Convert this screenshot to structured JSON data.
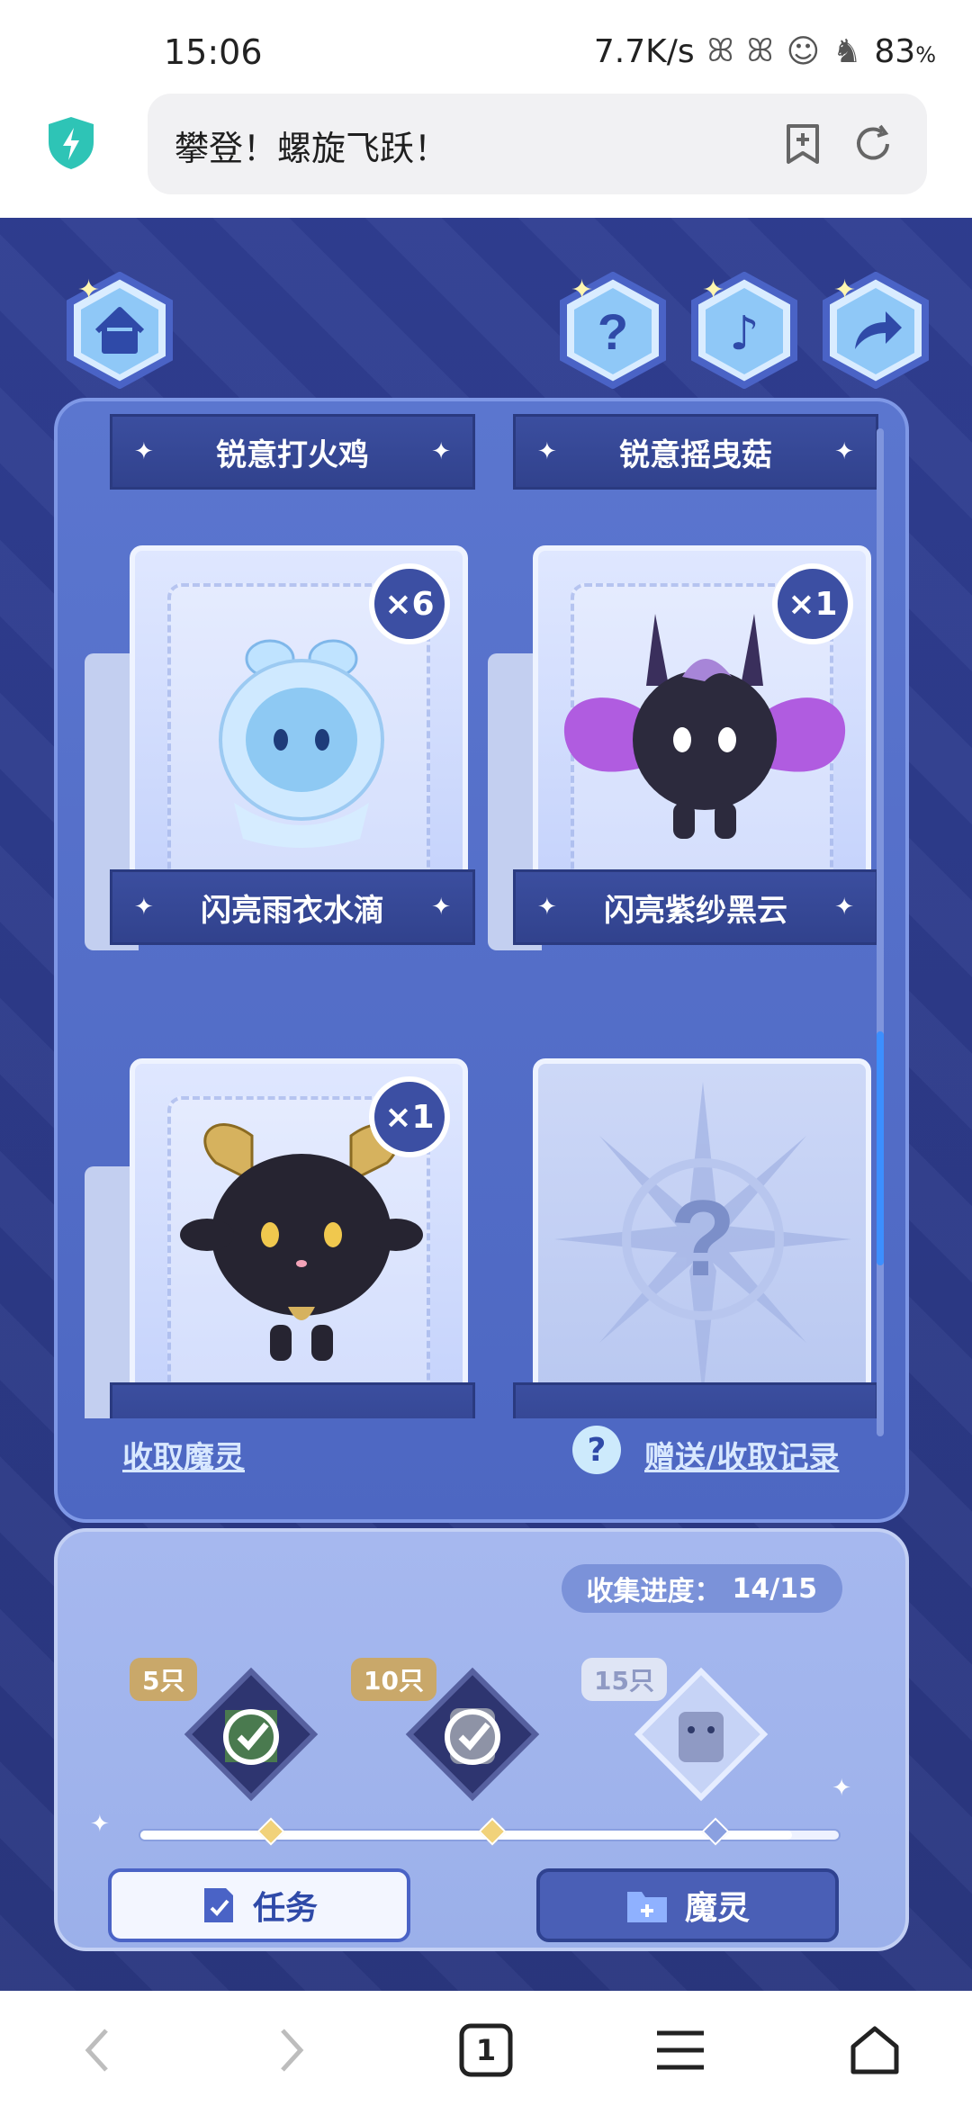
{
  "status_bar": {
    "time": "15:06",
    "net_speed": "7.7K/s",
    "battery": "83"
  },
  "browser": {
    "url_title": "攀登！螺旋飞跃！"
  },
  "header_icons": [
    "home-icon",
    "help-icon",
    "music-icon",
    "share-icon"
  ],
  "collection": {
    "banners_top": [
      "锐意打火鸡",
      "锐意摇曳菇"
    ],
    "cards": [
      {
        "name": "闪亮雨衣水滴",
        "count": "×6",
        "collected": true
      },
      {
        "name": "闪亮紫纱黑云",
        "count": "×1",
        "collected": true
      },
      {
        "name": "",
        "count": "×1",
        "collected": true
      },
      {
        "name": "",
        "count": "",
        "collected": false
      }
    ],
    "links": {
      "receive": "收取魔灵",
      "record": "赠送/收取记录"
    }
  },
  "progress": {
    "label": "收集进度：",
    "value": "14/15",
    "fraction": 0.933,
    "rewards": [
      {
        "tag": "5只",
        "claimed": true
      },
      {
        "tag": "10只",
        "claimed": true
      },
      {
        "tag": "15只",
        "claimed": false
      }
    ],
    "buttons": {
      "tasks": "任务",
      "spirits": "魔灵"
    }
  },
  "nav": {
    "tab_count": "1"
  },
  "colors": {
    "panel": "#5b76cf",
    "dark_banner": "#31428d",
    "accent_blue": "#3c8fff",
    "gold": "#f1d27a"
  }
}
